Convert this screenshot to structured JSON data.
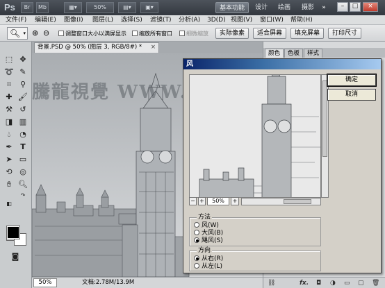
{
  "titlebar": {
    "logo": "Ps",
    "br_label": "Br",
    "mb_label": "Mb",
    "zoom": "50%",
    "workspaces": [
      "基本功能",
      "设计",
      "绘画",
      "摄影"
    ],
    "minimize": "–",
    "restore": "□",
    "close": "×"
  },
  "menu": [
    "文件(F)",
    "编辑(E)",
    "图像(I)",
    "图层(L)",
    "选择(S)",
    "滤镜(T)",
    "分析(A)",
    "3D(D)",
    "视图(V)",
    "窗口(W)",
    "帮助(H)"
  ],
  "options": {
    "chk_resize": "调整窗口大小以满屏显示",
    "chk_all": "缩放所有窗口",
    "chk_scrubby": "细微缩放",
    "btn_actual": "实际像素",
    "btn_fit": "适合屏幕",
    "btn_fill": "填充屏幕",
    "btn_print": "打印尺寸"
  },
  "document": {
    "tab_title": "背景.PSD @ 50% (图层 3, RGB/8#) *",
    "close": "×",
    "watermark": "騰龍視覺 WWW.TLVI.EI"
  },
  "status": {
    "zoom": "50%",
    "doc_info": "文档:2.78M/13.9M"
  },
  "panel": {
    "tabs": [
      "颜色",
      "色板",
      "样式"
    ],
    "footer_fx": "fx."
  },
  "dialog": {
    "title": "风",
    "ok": "确定",
    "cancel": "取消",
    "preview_zoom": "50%",
    "zoom_out": "−",
    "zoom_in": "+",
    "method": {
      "title": "方法",
      "options": [
        "风(W)",
        "大风(B)",
        "飓风(S)"
      ],
      "selected": 2
    },
    "direction": {
      "title": "方向",
      "options": [
        "从右(R)",
        "从左(L)"
      ],
      "selected": 0
    }
  }
}
